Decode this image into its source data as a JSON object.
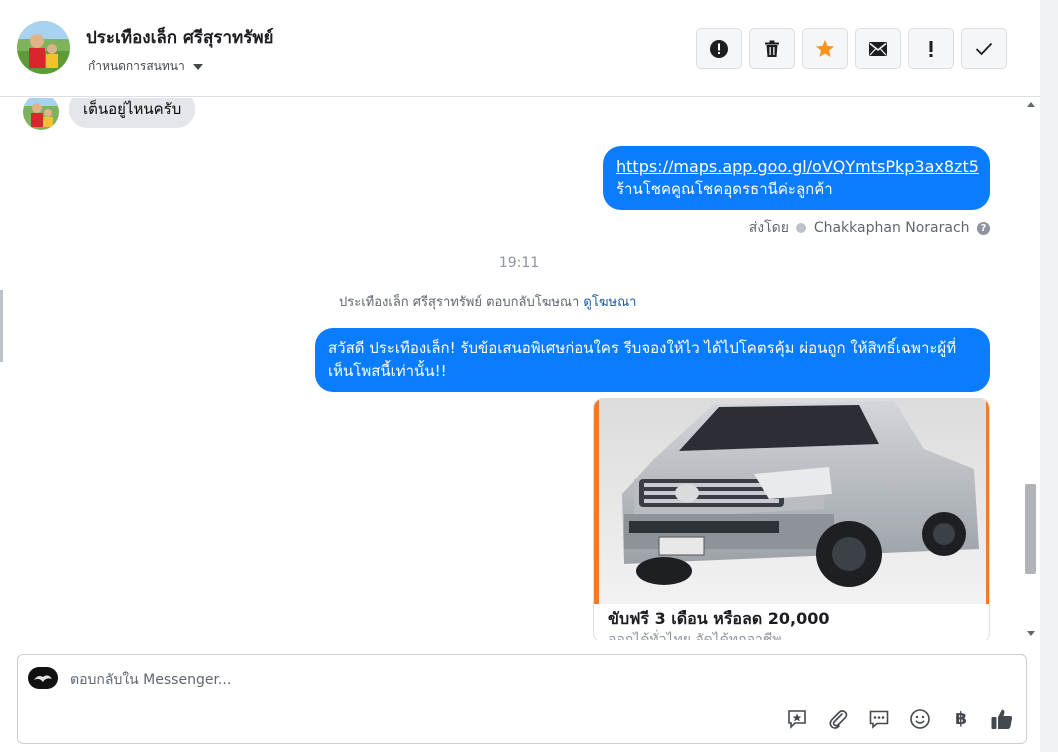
{
  "header": {
    "contact_name": "ประเทืองเล็ก ศรีสุราทรัพย์",
    "assign_label": "กำหนดการสนทนา"
  },
  "toolbar_icons": [
    "alert-circle-icon",
    "trash-icon",
    "star-icon",
    "envelope-icon",
    "exclamation-icon",
    "check-icon"
  ],
  "colors": {
    "outgoing_bubble": "#0a7cff",
    "incoming_bubble": "#e4e6eb",
    "star": "#f7931e"
  },
  "messages": {
    "incoming_text": "เต็นอยู่ไหนครับ",
    "outgoing_link": "https://maps.app.goo.gl/oVQYmtsPkp3ax8zt5",
    "outgoing_link_caption": "ร้านโชคคูณโชคอุดรธานีค่ะลูกค้า",
    "sent_by_label": "ส่งโดย",
    "sender_name": "Chakkaphan Norarach",
    "timestamp": "19:11",
    "ad_reply_note": "ประเทืองเล็ก ศรีสุราทรัพย์ ตอบกลับโฆษณา",
    "view_ad_link": "ดูโฆษณา",
    "ad_message": "สวัสดี ประเทืองเล็ก! รับข้อเสนอพิเศษก่อนใคร รีบจองให้ไว ได้ไปโคตรคุ้ม ผ่อนถูก ให้สิทธิ์เฉพาะผู้ที่เห็นโพสนี้เท่านั้น!!",
    "ad_card_title": "ขับฟรี 3 เดือน หรือลด 20,000",
    "ad_card_subtitle": "ออกได้ทั่วไทย จัดได้ทุกอาชีพ"
  },
  "composer": {
    "placeholder": "ตอบกลับใน Messenger...",
    "icons": [
      "saved-reply-icon",
      "attachment-icon",
      "chat-bubble-icon",
      "emoji-icon",
      "baht-icon",
      "thumbs-up-icon"
    ],
    "baht_symbol": "฿"
  }
}
